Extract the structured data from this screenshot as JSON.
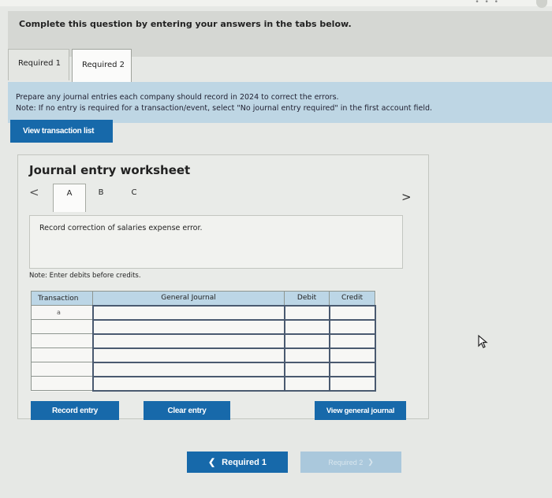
{
  "header": {
    "instruction": "Complete this question by entering your answers in the tabs below."
  },
  "tabs": [
    {
      "label": "Required 1"
    },
    {
      "label": "Required 2"
    }
  ],
  "instructions": {
    "line1": "Prepare any journal entries each company should record in 2024 to correct the errors.",
    "line2": "Note: If no entry is required for a transaction/event, select \"No journal entry required\" in the first account field."
  },
  "buttons": {
    "view_transaction_list": "View transaction list",
    "record_entry": "Record entry",
    "clear_entry": "Clear entry",
    "view_general_journal": "View general journal"
  },
  "worksheet": {
    "title": "Journal entry worksheet",
    "sub_tabs": [
      "A",
      "B",
      "C"
    ],
    "description": "Record correction of salaries expense error.",
    "note": "Note: Enter debits before credits.",
    "nav_prev_icon": "chevron-left-icon",
    "nav_next_icon": "chevron-right-icon"
  },
  "table": {
    "headers": {
      "transaction": "Transaction",
      "general_journal": "General Journal",
      "debit": "Debit",
      "credit": "Credit"
    },
    "rows": [
      {
        "transaction": "a",
        "account": "",
        "debit": "",
        "credit": ""
      },
      {
        "transaction": "",
        "account": "",
        "debit": "",
        "credit": ""
      },
      {
        "transaction": "",
        "account": "",
        "debit": "",
        "credit": ""
      },
      {
        "transaction": "",
        "account": "",
        "debit": "",
        "credit": ""
      },
      {
        "transaction": "",
        "account": "",
        "debit": "",
        "credit": ""
      },
      {
        "transaction": "",
        "account": "",
        "debit": "",
        "credit": ""
      }
    ]
  },
  "footer": {
    "prev_label": "Required 1",
    "next_label": "Required 2"
  },
  "colors": {
    "primary_blue": "#1769aa",
    "header_blue": "#bcd6e6",
    "disabled_blue": "#aac8dc"
  }
}
